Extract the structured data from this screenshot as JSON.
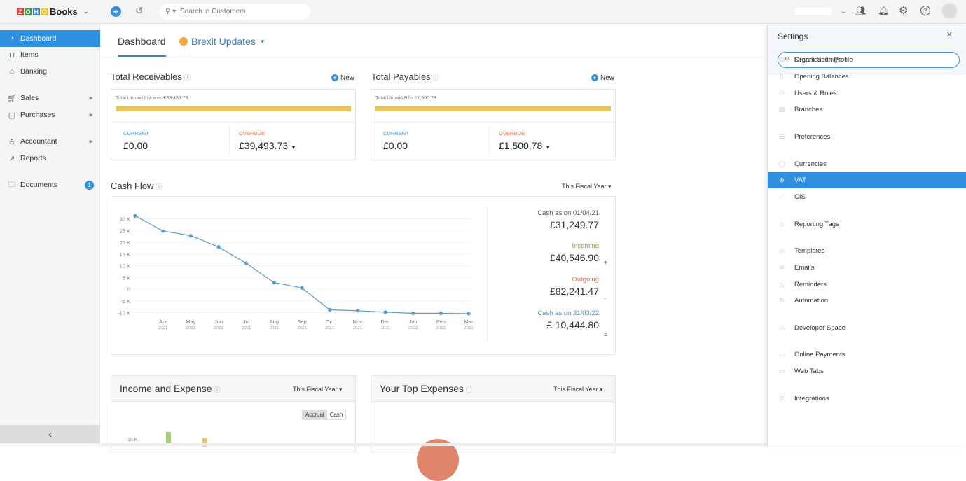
{
  "topbar": {
    "brand": "Books",
    "logo": "ZOHO",
    "search_placeholder": "Search in Customers",
    "icons": [
      "add-icon",
      "history-icon",
      "search-icon",
      "users-icon",
      "bell-icon",
      "gear-icon",
      "help-icon",
      "avatar"
    ]
  },
  "sidebar": {
    "items": [
      {
        "label": "Dashboard",
        "icon": "dashboard-icon",
        "active": true
      },
      {
        "label": "Items",
        "icon": "basket-icon"
      },
      {
        "label": "Banking",
        "icon": "bank-icon"
      },
      {
        "label": "Sales",
        "icon": "cart-icon",
        "has_submenu": true
      },
      {
        "label": "Purchases",
        "icon": "bag-icon",
        "has_submenu": true
      },
      {
        "label": "Accountant",
        "icon": "accountant-icon",
        "has_submenu": true
      },
      {
        "label": "Reports",
        "icon": "reports-icon"
      },
      {
        "label": "Documents",
        "icon": "folder-icon",
        "badge": "1"
      }
    ],
    "collapse": "‹"
  },
  "tabs": [
    {
      "label": "Dashboard",
      "active": true
    },
    {
      "label": "Brexit Updates"
    }
  ],
  "receivables": {
    "title": "Total Receivables",
    "new": "New",
    "unpaid": "Total Unpaid Invoices £39,493.73",
    "current_label": "CURRENT",
    "current": "£0.00",
    "overdue_label": "OVERDUE",
    "overdue": "£39,493.73"
  },
  "payables": {
    "title": "Total Payables",
    "new": "New",
    "unpaid": "Total Unpaid Bills £1,500.78",
    "current_label": "CURRENT",
    "current": "£0.00",
    "overdue_label": "OVERDUE",
    "overdue": "£1,500.78"
  },
  "cashflow": {
    "title": "Cash Flow",
    "period": "This Fiscal Year",
    "opening_label": "Cash as on 01/04/21",
    "opening": "£31,249.77",
    "incoming_label": "Incoming",
    "incoming": "£40,546.90",
    "incoming_sign": "+",
    "outgoing_label": "Outgoing",
    "outgoing": "£82,241.47",
    "outgoing_sign": "-",
    "closing_label": "Cash as on 31/03/22",
    "closing": "£-10,444.80",
    "closing_sign": "="
  },
  "chart_data": {
    "type": "line",
    "x": [
      "",
      "Apr 2021",
      "May 2021",
      "Jun 2021",
      "Jul 2021",
      "Aug 2021",
      "Sep 2021",
      "Oct 2021",
      "Nov 2021",
      "Dec 2021",
      "Jan 2022",
      "Feb 2022",
      "Mar 2022"
    ],
    "x_months": [
      "",
      "Apr",
      "May",
      "Jun",
      "Jul",
      "Aug",
      "Sep",
      "Oct",
      "Nov",
      "Dec",
      "Jan",
      "Feb",
      "Mar"
    ],
    "x_years": [
      "",
      "2021",
      "2021",
      "2021",
      "2021",
      "2021",
      "2021",
      "2021",
      "2021",
      "2021",
      "2022",
      "2022",
      "2022"
    ],
    "values": [
      31250,
      24800,
      22800,
      18000,
      11000,
      2800,
      500,
      -8800,
      -9200,
      -9800,
      -10300,
      -10300,
      -10445
    ],
    "yticks": [
      "30 K",
      "25 K",
      "20 K",
      "15 K",
      "10 K",
      "5 K",
      "0",
      "-5 K",
      "-10 K"
    ],
    "ylim": [
      -10000,
      30000
    ],
    "grid": true,
    "color": "#5b9bc8"
  },
  "income_expense": {
    "title": "Income and Expense",
    "period": "This Fiscal Year",
    "toggle": [
      "Accrual",
      "Cash"
    ],
    "ytick": "15 K"
  },
  "top_expenses": {
    "title": "Your Top Expenses",
    "period": "This Fiscal Year"
  },
  "settings": {
    "title": "Settings",
    "search_placeholder": "Search Settings",
    "items": [
      {
        "label": "Organisation Profile",
        "icon": "building-icon"
      },
      {
        "label": "Opening Balances",
        "icon": "ledger-icon"
      },
      {
        "label": "Users & Roles",
        "icon": "users-icon"
      },
      {
        "label": "Branches",
        "icon": "branch-icon"
      },
      {
        "label": "Preferences",
        "icon": "sliders-icon"
      },
      {
        "label": "Currencies",
        "icon": "currency-icon"
      },
      {
        "label": "VAT",
        "icon": "vat-icon",
        "active": true
      },
      {
        "label": "CIS",
        "icon": "cis-icon"
      },
      {
        "label": "Reporting Tags",
        "icon": "tag-icon"
      },
      {
        "label": "Templates",
        "icon": "template-icon"
      },
      {
        "label": "Emails",
        "icon": "email-icon"
      },
      {
        "label": "Reminders",
        "icon": "bell-icon"
      },
      {
        "label": "Automation",
        "icon": "refresh-icon"
      },
      {
        "label": "Developer Space",
        "icon": "code-icon"
      },
      {
        "label": "Online Payments",
        "icon": "payment-icon"
      },
      {
        "label": "Web Tabs",
        "icon": "window-icon"
      },
      {
        "label": "Integrations",
        "icon": "plug-icon"
      }
    ]
  },
  "colors": {
    "accent": "#2f8ee0",
    "bar": "#e6c35c",
    "overdue": "#e06b4a",
    "incoming": "#6aaa3a"
  }
}
